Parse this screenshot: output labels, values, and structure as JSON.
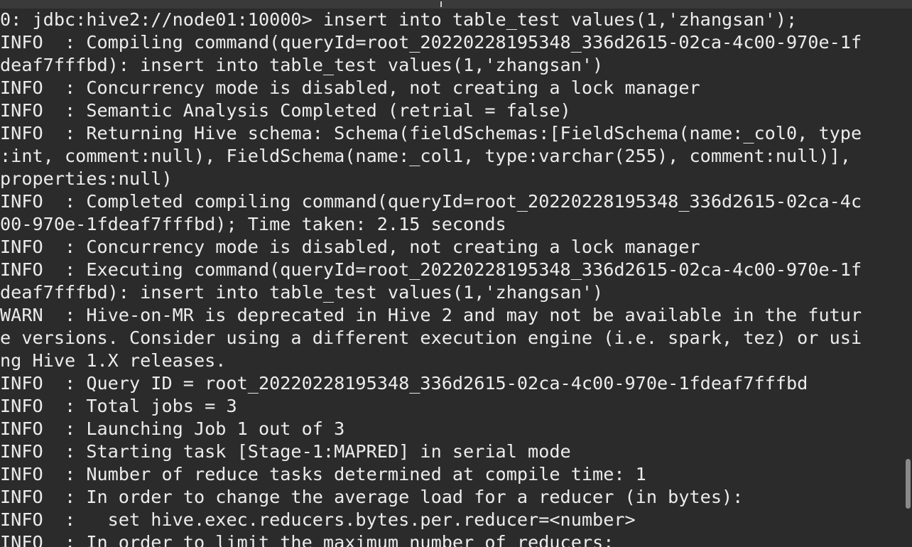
{
  "terminal": {
    "lines": [
      "0: jdbc:hive2://node01:10000> insert into table_test values(1,'zhangsan');",
      "INFO  : Compiling command(queryId=root_20220228195348_336d2615-02ca-4c00-970e-1f",
      "deaf7fffbd): insert into table_test values(1,'zhangsan')",
      "INFO  : Concurrency mode is disabled, not creating a lock manager",
      "INFO  : Semantic Analysis Completed (retrial = false)",
      "INFO  : Returning Hive schema: Schema(fieldSchemas:[FieldSchema(name:_col0, type",
      ":int, comment:null), FieldSchema(name:_col1, type:varchar(255), comment:null)],",
      "properties:null)",
      "INFO  : Completed compiling command(queryId=root_20220228195348_336d2615-02ca-4c",
      "00-970e-1fdeaf7fffbd); Time taken: 2.15 seconds",
      "INFO  : Concurrency mode is disabled, not creating a lock manager",
      "INFO  : Executing command(queryId=root_20220228195348_336d2615-02ca-4c00-970e-1f",
      "deaf7fffbd): insert into table_test values(1,'zhangsan')",
      "WARN  : Hive-on-MR is deprecated in Hive 2 and may not be available in the futur",
      "e versions. Consider using a different execution engine (i.e. spark, tez) or usi",
      "ng Hive 1.X releases.",
      "INFO  : Query ID = root_20220228195348_336d2615-02ca-4c00-970e-1fdeaf7fffbd",
      "INFO  : Total jobs = 3",
      "INFO  : Launching Job 1 out of 3",
      "INFO  : Starting task [Stage-1:MAPRED] in serial mode",
      "INFO  : Number of reduce tasks determined at compile time: 1",
      "INFO  : In order to change the average load for a reducer (in bytes):",
      "INFO  :   set hive.exec.reducers.bytes.per.reducer=<number>",
      "INFO  : In order to limit the maximum number of reducers:"
    ]
  },
  "colors": {
    "background": "#2b2b2b",
    "text": "#ececec",
    "scrollbar_thumb": "#8a8a8a"
  }
}
